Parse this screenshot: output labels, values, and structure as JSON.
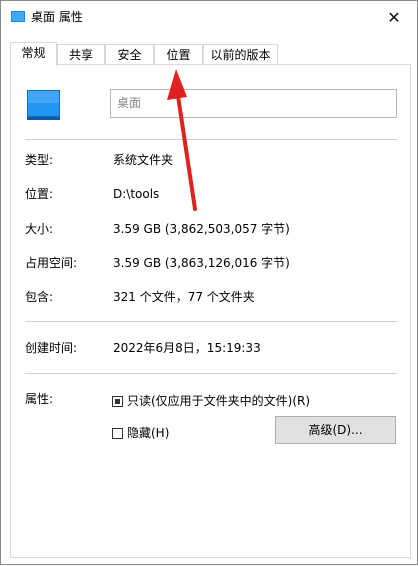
{
  "window": {
    "title": "桌面 属性",
    "close_glyph": "✕"
  },
  "tabs": [
    {
      "label": "常规",
      "active": true
    },
    {
      "label": "共享",
      "active": false
    },
    {
      "label": "安全",
      "active": false
    },
    {
      "label": "位置",
      "active": false
    },
    {
      "label": "以前的版本",
      "active": false
    }
  ],
  "general": {
    "folder_name": "桌面",
    "type_label": "类型:",
    "type_value": "系统文件夹",
    "location_label": "位置:",
    "location_value": "D:\\tools",
    "size_label": "大小:",
    "size_value": "3.59 GB (3,862,503,057 字节)",
    "size_on_disk_label": "占用空间:",
    "size_on_disk_value": "3.59 GB (3,863,126,016 字节)",
    "contains_label": "包含:",
    "contains_value": "321 个文件，77 个文件夹",
    "created_label": "创建时间:",
    "created_value": "2022年6月8日，15:19:33",
    "attributes_label": "属性:",
    "readonly_label": "只读(仅应用于文件夹中的文件)(R)",
    "readonly_checked": true,
    "hidden_label": "隐藏(H)",
    "hidden_checked": false,
    "advanced_button": "高级(D)..."
  },
  "colors": {
    "folder_blue": "#1e88e5",
    "arrow_red": "#e0211d"
  },
  "icons": {
    "title_icon": "folder-icon",
    "close": "close-icon",
    "folder": "desktop-folder-icon",
    "annotation": "red-arrow-icon"
  }
}
